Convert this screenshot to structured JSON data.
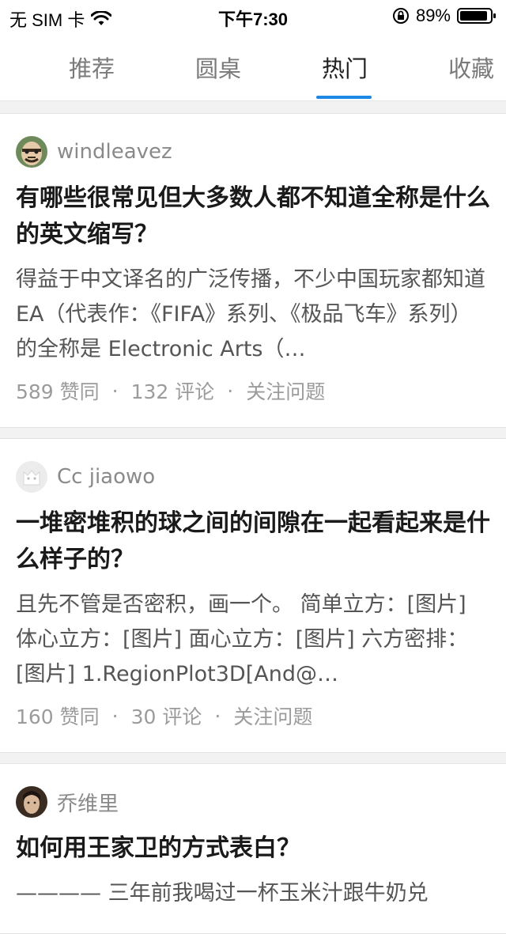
{
  "status_bar": {
    "carrier": "无 SIM 卡",
    "time": "下午7:30",
    "battery": "89%"
  },
  "tabs": [
    {
      "label": "推荐"
    },
    {
      "label": "圆桌"
    },
    {
      "label": "热门"
    },
    {
      "label": "收藏"
    }
  ],
  "active_tab": "热门",
  "feed": [
    {
      "author": "windleavez",
      "title": "有哪些很常见但大多数人都不知道全称是什么的英文缩写？",
      "excerpt": "得益于中文译名的广泛传播，不少中国玩家都知道 EA（代表作：《FIFA》系列、《极品飞车》系列）的全称是 Electronic Arts（…",
      "likes": "589 赞同",
      "comments": "132 评论",
      "follow": "关注问题"
    },
    {
      "author": "Cc jiaowo",
      "title": "一堆密堆积的球之间的间隙在一起看起来是什么样子的？",
      "excerpt": "且先不管是否密积，画一个。 简单立方：[图片] 体心立方：[图片] 面心立方：[图片] 六方密排：[图片] 1.RegionPlot3D[And@…",
      "likes": "160 赞同",
      "comments": "30 评论",
      "follow": "关注问题"
    },
    {
      "author": "乔维里",
      "title": "如何用王家卫的方式表白？",
      "excerpt": "———— 三年前我喝过一杯玉米汁跟牛奶兑",
      "likes": "",
      "comments": "",
      "follow": ""
    }
  ]
}
